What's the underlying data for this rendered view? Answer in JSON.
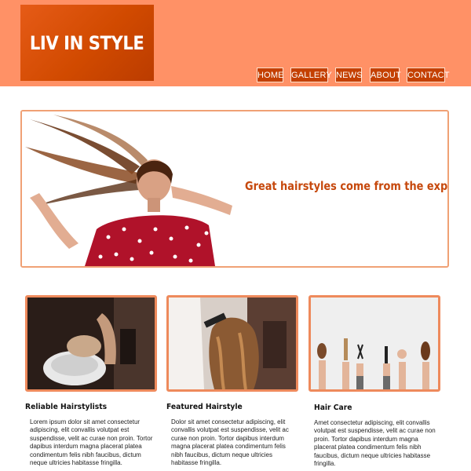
{
  "header": {
    "logo_text": "LIV IN STYLE"
  },
  "nav": {
    "items": [
      {
        "label": "HOME"
      },
      {
        "label": "GALLERY"
      },
      {
        "label": "NEWS"
      },
      {
        "label": "ABOUT"
      },
      {
        "label": "CONTACT"
      }
    ]
  },
  "hero": {
    "tagline": "Great hairstyles come from the experts."
  },
  "cards": [
    {
      "title": "Reliable Hairstylists",
      "body": "Lorem ipsum dolor sit amet consectetur adipiscing, elit convallis volutpat est suspendisse, velit ac curae non proin. Tortor dapibus interdum magna placerat platea condimentum felis nibh faucibus, dictum neque ultricies habitasse fringilla."
    },
    {
      "title": "Featured Hairstyle",
      "body": "Dolor sit amet consectetur adipiscing, elit convallis volutpat est suspendisse, velit ac curae non proin. Tortor dapibus interdum magna placerat platea condimentum felis nibh faucibus, dictum neque ultricies habitasse fringilla."
    },
    {
      "title": "Hair Care",
      "body": "Amet consectetur adipiscing, elit convallis volutpat est suspendisse, velit ac curae non proin. Tortor dapibus interdum magna placerat platea condimentum felis nibh faucibus, dictum neque ultricies habitasse fringilla."
    }
  ],
  "colors": {
    "header_bg": "#ff9166",
    "logo_bg": "#d14a00",
    "nav_bg": "#c44000",
    "accent_text": "#c6480c",
    "card_border": "#ee8a5c"
  }
}
